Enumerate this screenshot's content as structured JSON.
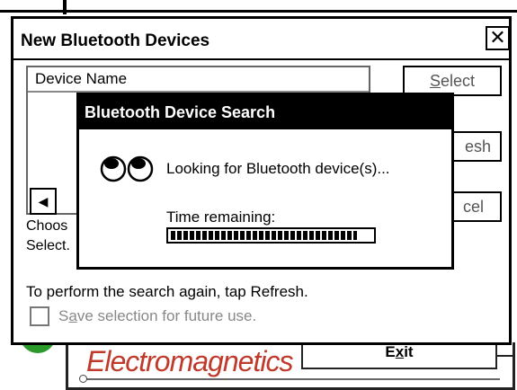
{
  "dialog": {
    "title": "New Bluetooth Devices",
    "close_glyph": "✕",
    "list": {
      "column_header": "Device Name",
      "scroll_left_glyph": "◀"
    },
    "buttons": {
      "select_prefix": "",
      "select_u": "S",
      "select_rest": "elect",
      "refresh_visible": "esh",
      "cancel_visible": "cel"
    },
    "choose_text_line1": "Choos",
    "choose_text_line2": "Select.",
    "refresh_instruction": "To perform the search again, tap Refresh.",
    "save_checkbox": {
      "prefix": "S",
      "u": "a",
      "rest": "ve selection for future use.",
      "checked": false
    }
  },
  "search_popup": {
    "title": "Bluetooth Device Search",
    "message": "Looking for Bluetooth device(s)...",
    "time_label": "Time remaining:",
    "progress": 0.93,
    "icon": "eyes-icon"
  },
  "background_app": {
    "logo_text": "Electromagnetics",
    "exit_prefix": "E",
    "exit_u": "x",
    "exit_rest": "it",
    "accent_red": "#c0392b",
    "accent_green": "#2a9a2a"
  }
}
